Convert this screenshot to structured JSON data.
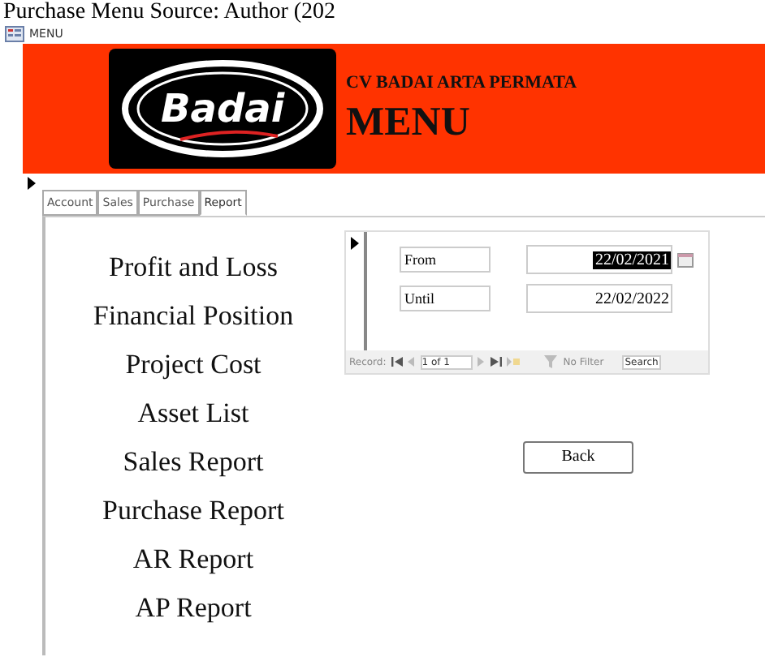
{
  "caption": "Purchase Menu Source: Author (202",
  "window": {
    "title": "MENU"
  },
  "header": {
    "company": "CV BADAI ARTA PERMATA",
    "title": "MENU",
    "logo_text": "Badai"
  },
  "tabs": [
    {
      "label": "Account",
      "selected": false
    },
    {
      "label": "Sales",
      "selected": false
    },
    {
      "label": "Purchase",
      "selected": false
    },
    {
      "label": "Report",
      "selected": true
    }
  ],
  "menu_items": [
    "Profit and Loss",
    "Financial Position",
    "Project Cost",
    "Asset List",
    "Sales Report",
    "Purchase Report",
    "AR Report",
    "AP Report"
  ],
  "subform": {
    "fields": [
      {
        "label": "From",
        "value": "22/02/2021",
        "selected": true
      },
      {
        "label": "Until",
        "value": "22/02/2022",
        "selected": false
      }
    ],
    "navigation": {
      "label": "Record:",
      "position": "1 of 1",
      "filter": "No Filter",
      "search": "Search"
    }
  },
  "buttons": [
    "Back"
  ]
}
